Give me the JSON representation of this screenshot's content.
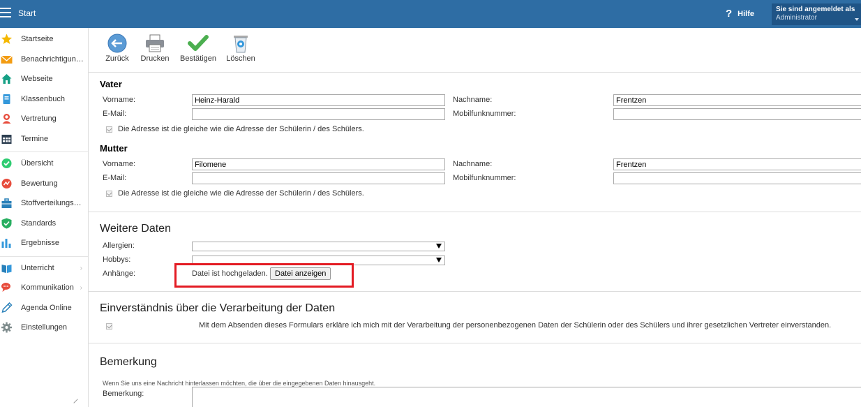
{
  "header": {
    "title": "Start",
    "help_label": "Hilfe",
    "user_line1": "Sie sind angemeldet als",
    "user_line2": "Administrator"
  },
  "sidebar": {
    "groups": [
      [
        {
          "label": "Startseite",
          "icon": "star-icon"
        },
        {
          "label": "Benachrichtigungen",
          "icon": "envelope-icon"
        },
        {
          "label": "Webseite",
          "icon": "home-icon"
        },
        {
          "label": "Klassenbuch",
          "icon": "book-icon"
        },
        {
          "label": "Vertretung",
          "icon": "person-icon"
        },
        {
          "label": "Termine",
          "icon": "calendar-icon"
        }
      ],
      [
        {
          "label": "Übersicht",
          "icon": "check-circle-icon"
        },
        {
          "label": "Bewertung",
          "icon": "rating-icon"
        },
        {
          "label": "Stoffverteilungsplan",
          "icon": "briefcase-icon"
        },
        {
          "label": "Standards",
          "icon": "shield-check-icon"
        },
        {
          "label": "Ergebnisse",
          "icon": "bar-chart-icon"
        }
      ],
      [
        {
          "label": "Unterricht",
          "icon": "open-book-icon",
          "has_submenu": true
        },
        {
          "label": "Kommunikation",
          "icon": "chat-icon",
          "has_submenu": true
        },
        {
          "label": "Agenda Online",
          "icon": "pen-icon"
        },
        {
          "label": "Einstellungen",
          "icon": "gear-icon"
        }
      ]
    ]
  },
  "toolbar": {
    "back_label": "Zurück",
    "print_label": "Drucken",
    "confirm_label": "Bestätigen",
    "delete_label": "Löschen"
  },
  "father": {
    "heading": "Vater",
    "firstname_label": "Vorname:",
    "firstname_value": "Heinz-Harald",
    "lastname_label": "Nachname:",
    "lastname_value": "Frentzen",
    "email_label": "E-Mail:",
    "email_value": "",
    "mobile_label": "Mobilfunknummer:",
    "mobile_value": "",
    "address_same_label": "Die Adresse ist die gleiche wie die Adresse der Schülerin / des Schülers."
  },
  "mother": {
    "heading": "Mutter",
    "firstname_label": "Vorname:",
    "firstname_value": "Filomene",
    "lastname_label": "Nachname:",
    "lastname_value": "Frentzen",
    "email_label": "E-Mail:",
    "email_value": "",
    "mobile_label": "Mobilfunknummer:",
    "mobile_value": "",
    "address_same_label": "Die Adresse ist die gleiche wie die Adresse der Schülerin / des Schülers."
  },
  "further": {
    "heading": "Weitere Daten",
    "allergies_label": "Allergien:",
    "hobbies_label": "Hobbys:",
    "attachments_label": "Anhänge:",
    "uploaded_text": "Datei ist hochgeladen.",
    "show_file_label": "Datei anzeigen"
  },
  "consent": {
    "heading": "Einverständnis über die Verarbeitung der Daten",
    "text": "Mit dem Absenden dieses Formulars erkläre ich mich mit der Verarbeitung der personenbezogenen Daten der Schülerin oder des Schülers und ihrer gesetzlichen Vertreter einverstanden."
  },
  "remark": {
    "heading": "Bemerkung",
    "hint": "Wenn Sie uns eine Nachricht hinterlassen möchten, die über die eingegebenen Daten hinausgeht.",
    "label": "Bemerkung:"
  },
  "colors": {
    "header_bg": "#2e6da4",
    "highlight": "#e31b23"
  }
}
